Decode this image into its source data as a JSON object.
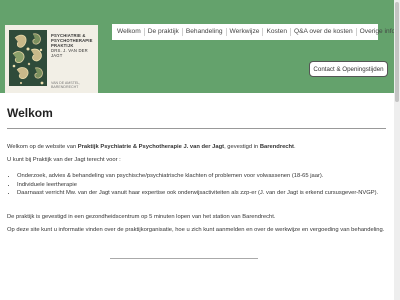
{
  "logo": {
    "line1": "PSYCHIATRIE &",
    "line2": "PSYCHOTHERAPIE",
    "line3": "PRAKTIJK",
    "line4": "DRS. J. VAN DER JAGT",
    "caption": "VAN DE AMSTEL, BARENDRECHT"
  },
  "nav": {
    "items": [
      "Welkom",
      "De praktijk",
      "Behandeling",
      "Werkwijze",
      "Kosten",
      "Q&A over de kosten",
      "Overige informatie"
    ]
  },
  "contact_button": "Contact & Openingstijden",
  "main": {
    "title": "Welkom",
    "intro_prefix": "Welkom op de website van ",
    "intro_name": "Praktijk Psychiatrie & Psychotherapie J. van der Jagt",
    "intro_mid": ", gevestigd in ",
    "intro_city": "Barendrecht",
    "intro_end": ".",
    "list_intro": "U kunt bij Praktijk van der Jagt terecht voor :",
    "bullets": [
      "Onderzoek, advies & behandeling van psychische/psychiatrische klachten of problemen voor volwassenen (18-65 jaar).",
      "Individuele leertherapie",
      "Daarnaast verricht Mw. van der Jagt vanuit haar expertise ook onderwijsactiviteiten als zzp-er (J. van der Jagt is erkend cursusgever-NVGP)."
    ],
    "location": "De praktijk is gevestigd in een gezondheidscentrum op 5 minuten lopen van het station van Barendrecht.",
    "closing": "Op deze site kunt u informatie vinden over de praktijkorganisatie, hoe u zich kunt aanmelden en over de werkwijze en vergoeding van behandeling."
  }
}
